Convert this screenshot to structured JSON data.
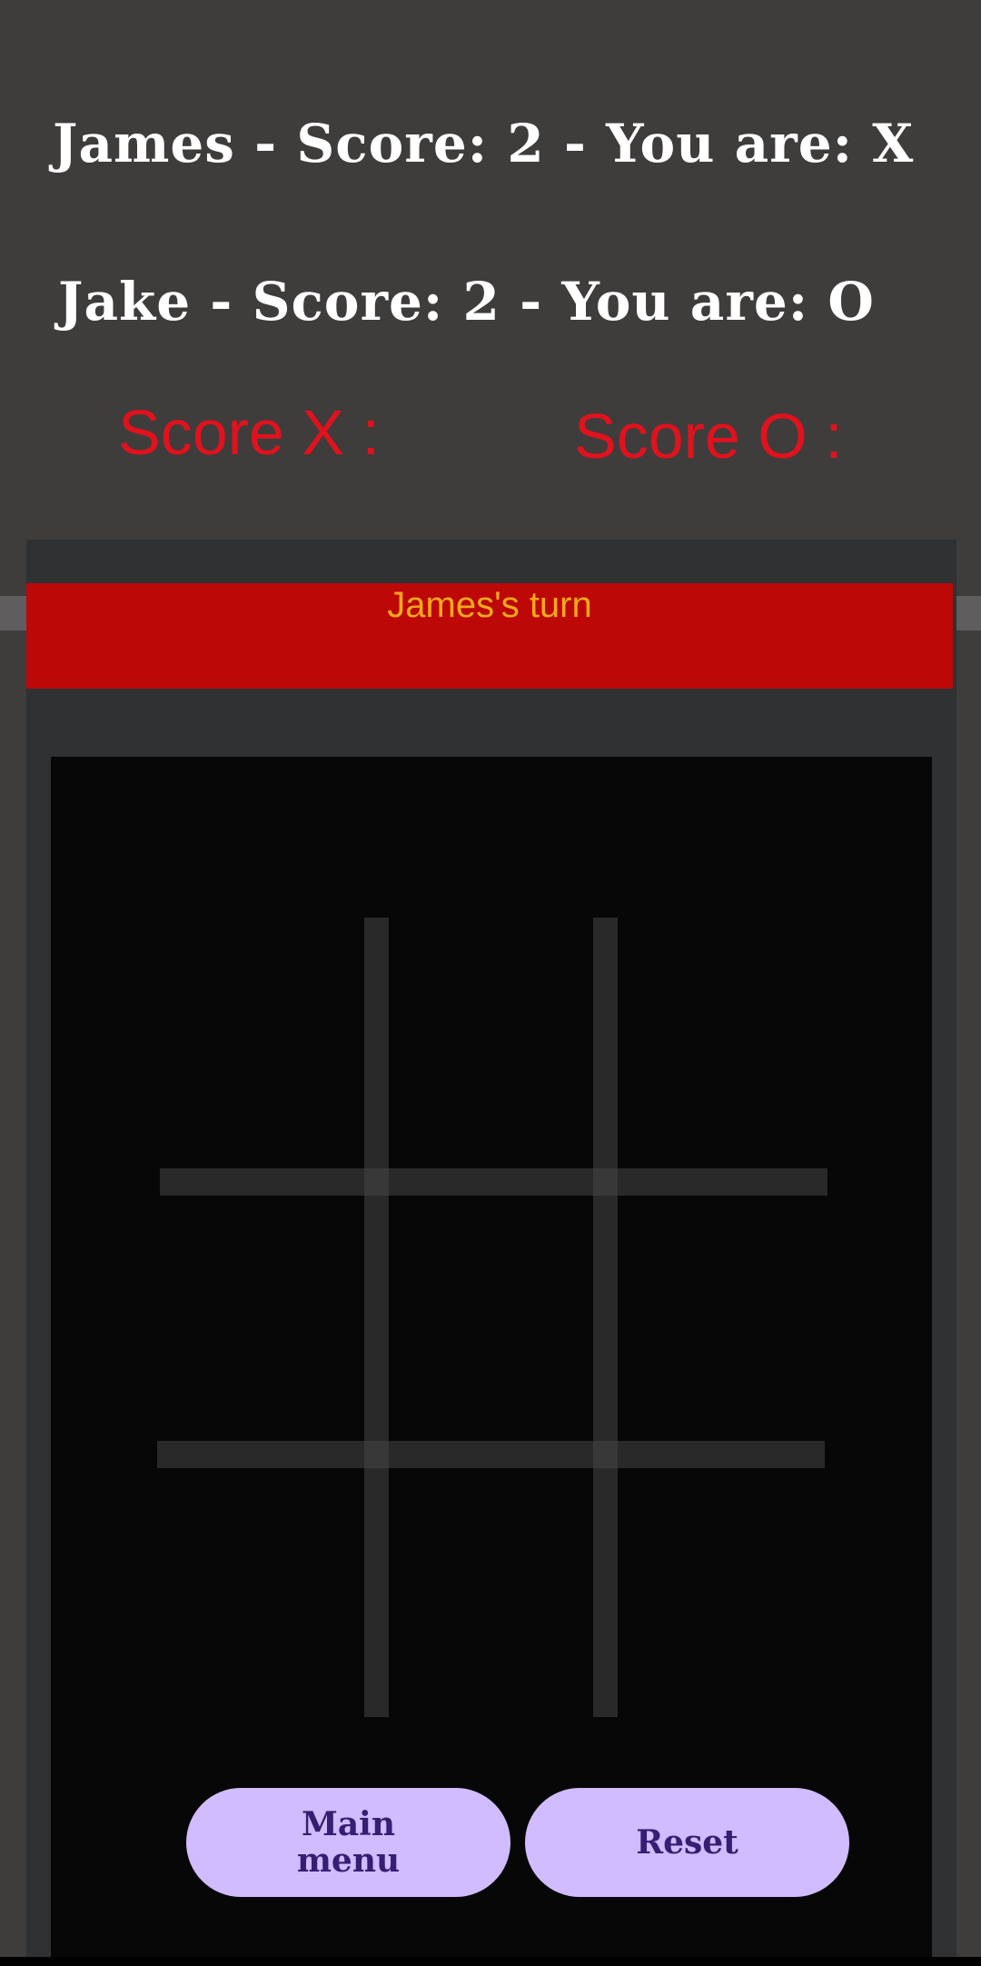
{
  "players": {
    "player1_line": "James - Score: 2 - You are: X",
    "player2_line": "Jake - Score: 2 - You are: O"
  },
  "scores": {
    "x_label": "Score X :",
    "o_label": "Score O :"
  },
  "turn": {
    "text": "James's turn"
  },
  "board": {
    "cells": [
      "",
      "",
      "",
      "",
      "",
      "",
      "",
      "",
      ""
    ]
  },
  "buttons": {
    "main_menu": "Main menu",
    "reset": "Reset"
  },
  "colors": {
    "background": "#3f3c3c",
    "score_red": "#e0121d",
    "banner_red": "#bd0808",
    "turn_text": "#f2a91b",
    "button_fill": "#d0bcff",
    "button_text": "#381e72"
  }
}
